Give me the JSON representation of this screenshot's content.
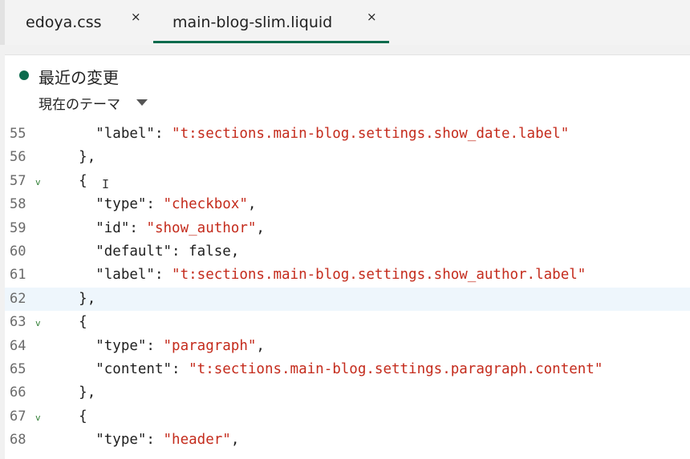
{
  "tabs": [
    {
      "label": "edoya.css",
      "close": "×",
      "active": false
    },
    {
      "label": "main-blog-slim.liquid",
      "close": "×",
      "active": true
    }
  ],
  "header": {
    "title": "最近の変更",
    "theme_selector": "現在のテーマ"
  },
  "colors": {
    "accent": "#0b6b4d",
    "string": "#c42b1c",
    "current_line": "#eef6fc"
  },
  "editor": {
    "current_line": 62,
    "lines": [
      {
        "num": "55",
        "fold": "",
        "indent": "      ",
        "parts": [
          {
            "t": "\"label\": ",
            "s": false
          },
          {
            "t": "\"t:sections.main-blog.settings.show_date.label\"",
            "s": true
          }
        ]
      },
      {
        "num": "56",
        "fold": "",
        "indent": "    ",
        "parts": [
          {
            "t": "},",
            "s": false
          }
        ]
      },
      {
        "num": "57",
        "fold": "v",
        "indent": "    ",
        "parts": [
          {
            "t": "{",
            "s": false
          }
        ]
      },
      {
        "num": "58",
        "fold": "",
        "indent": "      ",
        "parts": [
          {
            "t": "\"type\": ",
            "s": false
          },
          {
            "t": "\"checkbox\"",
            "s": true
          },
          {
            "t": ",",
            "s": false
          }
        ]
      },
      {
        "num": "59",
        "fold": "",
        "indent": "      ",
        "parts": [
          {
            "t": "\"id\": ",
            "s": false
          },
          {
            "t": "\"show_author\"",
            "s": true
          },
          {
            "t": ",",
            "s": false
          }
        ]
      },
      {
        "num": "60",
        "fold": "",
        "indent": "      ",
        "parts": [
          {
            "t": "\"default\": false,",
            "s": false
          }
        ]
      },
      {
        "num": "61",
        "fold": "",
        "indent": "      ",
        "parts": [
          {
            "t": "\"label\": ",
            "s": false
          },
          {
            "t": "\"t:sections.main-blog.settings.show_author.label\"",
            "s": true
          }
        ]
      },
      {
        "num": "62",
        "fold": "",
        "indent": "    ",
        "parts": [
          {
            "t": "},",
            "s": false
          }
        ]
      },
      {
        "num": "63",
        "fold": "v",
        "indent": "    ",
        "parts": [
          {
            "t": "{",
            "s": false
          }
        ]
      },
      {
        "num": "64",
        "fold": "",
        "indent": "      ",
        "parts": [
          {
            "t": "\"type\": ",
            "s": false
          },
          {
            "t": "\"paragraph\"",
            "s": true
          },
          {
            "t": ",",
            "s": false
          }
        ]
      },
      {
        "num": "65",
        "fold": "",
        "indent": "      ",
        "parts": [
          {
            "t": "\"content\": ",
            "s": false
          },
          {
            "t": "\"t:sections.main-blog.settings.paragraph.content\"",
            "s": true
          }
        ]
      },
      {
        "num": "66",
        "fold": "",
        "indent": "    ",
        "parts": [
          {
            "t": "},",
            "s": false
          }
        ]
      },
      {
        "num": "67",
        "fold": "v",
        "indent": "    ",
        "parts": [
          {
            "t": "{",
            "s": false
          }
        ]
      },
      {
        "num": "68",
        "fold": "",
        "indent": "      ",
        "parts": [
          {
            "t": "\"type\": ",
            "s": false
          },
          {
            "t": "\"header\"",
            "s": true
          },
          {
            "t": ",",
            "s": false
          }
        ]
      }
    ]
  }
}
